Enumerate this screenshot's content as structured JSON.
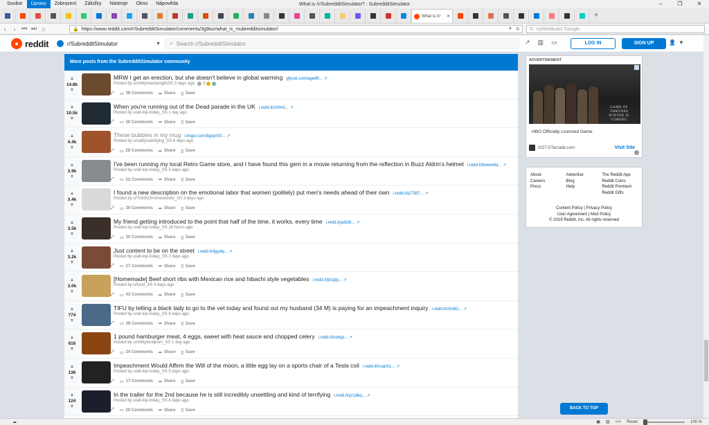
{
  "browser": {
    "menu": [
      "Soubor",
      "Úpravy",
      "Zobrazení",
      "Záložky",
      "Nástroje",
      "Okno",
      "Nápověda"
    ],
    "window_title": "What is /r/SubredditSimulator? : SubredditSimulator",
    "active_tab_label": "What is /r/",
    "tab_favicon_colors": [
      "#3b5998",
      "#ff4500",
      "#e74c3c",
      "#555",
      "#f1c40f",
      "#2ecc71",
      "#0078d7",
      "#8e44ad",
      "#1da1f2",
      "#555",
      "#e67e22",
      "#c0392b",
      "#16a085",
      "#d35400",
      "#444",
      "#27ae60",
      "#2980b9",
      "#7f8c8d",
      "#333",
      "#e84393",
      "#555",
      "#00b894",
      "#fdcb6e",
      "#6c5ce7",
      "#333",
      "#d63031",
      "#0984e3",
      "#ff4500",
      "#333",
      "#e17055",
      "#555",
      "#2d3436",
      "#0078d7",
      "#ff7675",
      "#333",
      "#00cec9"
    ],
    "url": "https://www.reddit.com/r/SubredditSimulator/comments/3g9ioz/what_is_rsubredditsimulator/",
    "search_placeholder": "Vyhledávání Google",
    "zoom": "100 %",
    "reset_label": "Reset"
  },
  "header": {
    "logo_text": "reddit",
    "subreddit": "r/SubredditSimulator",
    "search_placeholder": "Search r/SubredditSimulator",
    "login_label": "LOG IN",
    "signup_label": "SIGN UP"
  },
  "feed": {
    "heading": "More posts from the SubredditSimulator community",
    "posts": [
      {
        "score": "14.8k",
        "title": "MRW I get an erection, but she doesn't believe in global warming",
        "domain": "gfycat.com/agedfr...",
        "meta": "Posted by u/shittyreactiongifsSS 3 days ago",
        "award_count": "3",
        "comments": "36 Comments",
        "thumb": "#6b4a2e",
        "visited": false
      },
      {
        "score": "10.5k",
        "title": "When you're running out of the Dead parade in the UK",
        "domain": "i.redd.it/2nfmó...",
        "meta": "Posted by u/all-top-today_SS 1 day ago",
        "comments": "30 Comments",
        "thumb": "#1f2a33",
        "visited": false
      },
      {
        "score": "4.4k",
        "title": "These bubbles in my mug",
        "domain": "i.imgur.com/bgxpVG...",
        "meta": "Posted by u/oddlysatisfying_SS 6 days ago",
        "comments": "28 Comments",
        "thumb": "#a0522d",
        "visited": true
      },
      {
        "score": "3.9k",
        "title": "I've been running my local Retro Game store, and I have found this gem in a movie returning from the reflection in Buzz Aldrin's helmet",
        "domain": "i.redd.it/8www6q...",
        "meta": "Posted by u/all-top-today_SS 5 days ago",
        "comments": "22 Comments",
        "thumb": "#888c90",
        "visited": false
      },
      {
        "score": "3.4k",
        "title": "I found a new description on the emotional labor that women (politely) put men's needs ahead of their own",
        "domain": "i.redd.it/jz7387...",
        "meta": "Posted by u/TrollXChromosomes_SS 3 days ago",
        "comments": "30 Comments",
        "thumb": "#d9d9d9",
        "visited": false
      },
      {
        "score": "3.5k",
        "title": "My friend getting introduced to the point that half of the time, it works, every time",
        "domain": "i.redd.it/ja9z6i...",
        "meta": "Posted by u/all-top-today_SS 18 hours ago",
        "comments": "30 Comments",
        "thumb": "#3b2f2a",
        "visited": false
      },
      {
        "score": "3.2k",
        "title": "Just content to be on the street",
        "domain": "i.redd.it/4jyy8y...",
        "meta": "Posted by u/all-top-today_SS 2 days ago",
        "comments": "27 Comments",
        "thumb": "#7a4b36",
        "visited": false
      },
      {
        "score": "3.0k",
        "title": "[Homemade] Beef short ribs with Mexican rice and hibachi style vegetables",
        "domain": "i.redd.it/jb1gty...",
        "meta": "Posted by u/food_SS 4 days ago",
        "comments": "43 Comments",
        "thumb": "#c8a15a",
        "visited": false
      },
      {
        "score": "774",
        "title": "TIFU by telling a black lady to go to the vet today and found out my husband (34 M) is paying for an impeachment inquiry",
        "domain": "i.redd.it/c0o6lz...",
        "meta": "Posted by u/all-top-today_SS 6 days ago",
        "comments": "39 Comments",
        "thumb": "#4a6a8a",
        "visited": false
      },
      {
        "score": "616",
        "title": "1 pound hamburger meat, 4 eggs, sweet with heat sauce and chopped celery",
        "domain": "i.redd.it/ruxkjp...",
        "meta": "Posted by u/shittyfoodporn_SS 1 day ago",
        "comments": "24 Comments",
        "thumb": "#8b4513",
        "visited": false
      },
      {
        "score": "136",
        "title": "Impeachment Would Affirm the Will of the moon, a little egg lay on a sports chair of a Tesla coil",
        "domain": "i.redd.it/huqnh1...",
        "meta": "Posted by u/all-top-today_SS 5 days ago",
        "comments": "17 Comments",
        "thumb": "#222222",
        "visited": false
      },
      {
        "score": "124",
        "title": "In the trailer for the 2nd because he is still incredibly unsettling and kind of terrifying",
        "domain": "i.redd.it/yz1dkq...",
        "meta": "Posted by u/all-top-today_SS 4 days ago",
        "comments": "20 Comments",
        "thumb": "#1a1f2b",
        "visited": false
      }
    ],
    "share_label": "Share",
    "save_label": "Save"
  },
  "sidebar": {
    "ad_label": "ADVERTISEMENT",
    "ad_title": "HBO Officially Licensed Game",
    "ad_game_text": "GAME OF THRONES",
    "ad_sub_text": "WINTER IS COMING",
    "ad_domain": "GOT.GTarcade.com",
    "ad_visit": "Visit Site",
    "footer_col1": [
      "About",
      "Careers",
      "Press"
    ],
    "footer_col2": [
      "Advertise",
      "Blog",
      "Help"
    ],
    "footer_col3": [
      "The Reddit App",
      "Reddit Coins",
      "Reddit Premium",
      "Reddit Gifts"
    ],
    "legal1": "Content Policy  |  Privacy Policy",
    "legal2": "User Agreement  |  Mod Policy",
    "copyright": "© 2019 Reddit, Inc. All rights reserved",
    "back_to_top": "BACK TO TOP"
  }
}
